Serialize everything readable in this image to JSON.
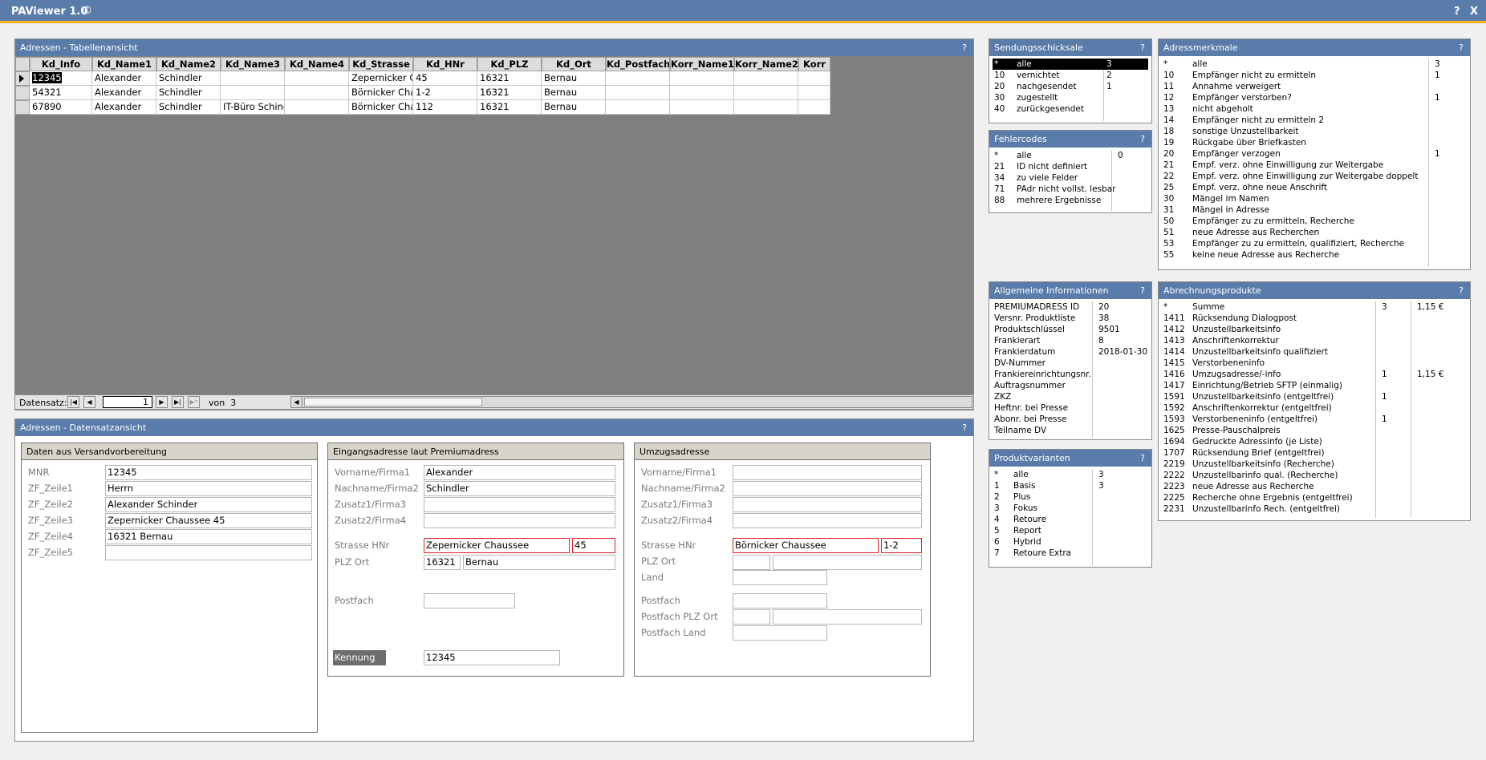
{
  "app": {
    "title": "PAViewer 1.0",
    "copyright": "©",
    "help": "?",
    "close": "X"
  },
  "table_panel": {
    "title": "Adressen - Tabellenansicht",
    "help": "?",
    "columns": [
      "Kd_Info",
      "Kd_Name1",
      "Kd_Name2",
      "Kd_Name3",
      "Kd_Name4",
      "Kd_Strasse",
      "Kd_HNr",
      "Kd_PLZ",
      "Kd_Ort",
      "Kd_Postfach",
      "Korr_Name1",
      "Korr_Name2",
      "Korr"
    ],
    "rows": [
      [
        "12345",
        "Alexander",
        "Schindler",
        "",
        "",
        "Zepernicker Ch",
        "45",
        "16321",
        "Bernau",
        "",
        "",
        "",
        ""
      ],
      [
        "54321",
        "Alexander",
        "Schindler",
        "",
        "",
        "Börnicker Chau",
        "1-2",
        "16321",
        "Bernau",
        "",
        "",
        "",
        ""
      ],
      [
        "67890",
        "Alexander",
        "Schindler",
        "IT-Büro Schindl",
        "",
        "Börnicker Chau",
        "112",
        "16321",
        "Bernau",
        "",
        "",
        "",
        ""
      ]
    ],
    "nav": {
      "label": "Datensatz:",
      "current": "1",
      "of_label": "von",
      "total": "3",
      "first": "|◀",
      "prev": "◀",
      "next": "▶",
      "last": "▶|",
      "new": "▶*"
    }
  },
  "detail_panel": {
    "title": "Adressen - Datensatzansicht",
    "help": "?",
    "versand": {
      "title": "Daten aus Versandvorbereitung",
      "fields": [
        {
          "label": "MNR",
          "value": "12345"
        },
        {
          "label": "ZF_Zeile1",
          "value": "Herrn"
        },
        {
          "label": "ZF_Zeile2",
          "value": "Alexander Schinder"
        },
        {
          "label": "ZF_Zeile3",
          "value": "Zepernicker Chaussee 45"
        },
        {
          "label": "ZF_Zeile4",
          "value": "16321 Bernau"
        },
        {
          "label": "ZF_Zeile5",
          "value": ""
        }
      ]
    },
    "eingang": {
      "title": "Eingangsadresse laut Premiumadress",
      "fields": [
        {
          "label": "Vorname/Firma1",
          "value": "Alexander"
        },
        {
          "label": "Nachname/Firma2",
          "value": "Schindler"
        },
        {
          "label": "Zusatz1/Firma3",
          "value": ""
        },
        {
          "label": "Zusatz2/Firma4",
          "value": ""
        }
      ],
      "strasse_label": "Strasse HNr",
      "strasse": "Zepernicker Chaussee",
      "hnr": "45",
      "plz_label": "PLZ Ort",
      "plz": "16321",
      "ort": "Bernau",
      "postfach_label": "Postfach",
      "postfach": "",
      "kennung_label": "Kennung",
      "kennung": "12345"
    },
    "umzug": {
      "title": "Umzugsadresse",
      "fields": [
        {
          "label": "Vorname/Firma1",
          "value": ""
        },
        {
          "label": "Nachname/Firma2",
          "value": ""
        },
        {
          "label": "Zusatz1/Firma3",
          "value": ""
        },
        {
          "label": "Zusatz2/Firma4",
          "value": ""
        }
      ],
      "strasse_label": "Strasse HNr",
      "strasse": "Börnicker Chaussee",
      "hnr": "1-2",
      "plz_label": "PLZ Ort",
      "plz": "",
      "ort": "",
      "land_label": "Land",
      "land": "",
      "postfach_label": "Postfach",
      "postfach": "",
      "postfach_plz_label": "Postfach PLZ Ort",
      "postfach_plz": "",
      "postfach_ort": "",
      "postfach_land_label": "Postfach Land",
      "postfach_land": ""
    }
  },
  "sendung": {
    "title": "Sendungsschicksale",
    "help": "?",
    "rows": [
      [
        "*",
        "alle",
        "3"
      ],
      [
        "10",
        "vernichtet",
        "2"
      ],
      [
        "20",
        "nachgesendet",
        "1"
      ],
      [
        "30",
        "zugestellt",
        ""
      ],
      [
        "40",
        "zurückgesendet",
        ""
      ]
    ]
  },
  "fehler": {
    "title": "Fehlercodes",
    "help": "?",
    "rows": [
      [
        "*",
        "alle",
        "0"
      ],
      [
        "21",
        "ID nicht definiert",
        ""
      ],
      [
        "34",
        "zu viele Felder",
        ""
      ],
      [
        "71",
        "PAdr nicht vollst. lesbar",
        ""
      ],
      [
        "88",
        "mehrere Ergebnisse",
        ""
      ]
    ]
  },
  "allg": {
    "title": "Allgemeine Informationen",
    "help": "?",
    "rows": [
      [
        "PREMIUMADRESS ID",
        "20"
      ],
      [
        "Versnr. Produktliste",
        "38"
      ],
      [
        "Produktschlüssel",
        "9501"
      ],
      [
        "Frankierart",
        "8"
      ],
      [
        "Frankierdatum",
        "2018-01-30"
      ],
      [
        "DV-Nummer",
        ""
      ],
      [
        "Frankiereinrichtungsnr.",
        ""
      ],
      [
        "Auftragsnummer",
        ""
      ],
      [
        "ZKZ",
        ""
      ],
      [
        "Heftnr. bei Presse",
        ""
      ],
      [
        "Abonr. bei Presse",
        ""
      ],
      [
        "Teilname DV",
        ""
      ]
    ]
  },
  "produkt": {
    "title": "Produktvarianten",
    "help": "?",
    "rows": [
      [
        "*",
        "alle",
        "3"
      ],
      [
        "1",
        "Basis",
        "3"
      ],
      [
        "2",
        "Plus",
        ""
      ],
      [
        "3",
        "Fokus",
        ""
      ],
      [
        "4",
        "Retoure",
        ""
      ],
      [
        "5",
        "Report",
        ""
      ],
      [
        "6",
        "Hybrid",
        ""
      ],
      [
        "7",
        "Retoure Extra",
        ""
      ]
    ]
  },
  "adress": {
    "title": "Adressmerkmale",
    "help": "?",
    "rows": [
      [
        "*",
        "alle",
        "3"
      ],
      [
        "10",
        "Empfänger nicht zu ermitteln",
        "1"
      ],
      [
        "11",
        "Annahme verweigert",
        ""
      ],
      [
        "12",
        "Empfänger verstorben?",
        "1"
      ],
      [
        "13",
        "nicht abgeholt",
        ""
      ],
      [
        "14",
        "Empfänger nicht zu ermitteln 2",
        ""
      ],
      [
        "18",
        "sonstige Unzustellbarkeit",
        ""
      ],
      [
        "19",
        "Rückgabe über Briefkasten",
        ""
      ],
      [
        "20",
        "Empfänger verzogen",
        "1"
      ],
      [
        "21",
        "Empf. verz. ohne Einwilligung zur Weitergabe",
        ""
      ],
      [
        "22",
        "Empf. verz. ohne Einwilligung zur Weitergabe doppelt",
        ""
      ],
      [
        "25",
        "Empf. verz. ohne neue Anschrift",
        ""
      ],
      [
        "30",
        "Mängel im Namen",
        ""
      ],
      [
        "31",
        "Mängel in Adresse",
        ""
      ],
      [
        "50",
        "Empfänger zu zu ermitteln, Recherche",
        ""
      ],
      [
        "51",
        "neue Adresse aus Recherchen",
        ""
      ],
      [
        "53",
        "Empfänger zu zu ermitteln, qualifiziert, Recherche",
        ""
      ],
      [
        "55",
        "keine neue Adresse aus Recherche",
        ""
      ]
    ]
  },
  "abrech": {
    "title": "Abrechnungsprodukte",
    "help": "?",
    "rows": [
      [
        "*",
        "Summe",
        "3",
        "1,15 €"
      ],
      [
        "1411",
        "Rücksendung Dialogpost",
        "",
        ""
      ],
      [
        "1412",
        "Unzustellbarkeitsinfo",
        "",
        ""
      ],
      [
        "1413",
        "Anschriftenkorrektur",
        "",
        ""
      ],
      [
        "1414",
        "Unzustellbarkeitsinfo qualifiziert",
        "",
        ""
      ],
      [
        "1415",
        "Verstorbeneninfo",
        "",
        ""
      ],
      [
        "1416",
        "Umzugsadresse/-info",
        "1",
        "1,15 €"
      ],
      [
        "1417",
        "Einrichtung/Betrieb SFTP (einmalig)",
        "",
        ""
      ],
      [
        "1591",
        "Unzustellbarkeitsinfo (entgeltfrei)",
        "1",
        ""
      ],
      [
        "1592",
        "Anschriftenkorrektur (entgeltfrei)",
        "",
        ""
      ],
      [
        "1593",
        "Verstorbeneninfo (entgeltfrei)",
        "1",
        ""
      ],
      [
        "1625",
        "Presse-Pauschalpreis",
        "",
        ""
      ],
      [
        "1694",
        "Gedruckte Adressinfo (je Liste)",
        "",
        ""
      ],
      [
        "1707",
        "Rücksendung Brief (entgeltfrei)",
        "",
        ""
      ],
      [
        "2219",
        "Unzustellbarkeitsinfo (Recherche)",
        "",
        ""
      ],
      [
        "2222",
        "Unzustellbarinfo qual. (Recherche)",
        "",
        ""
      ],
      [
        "2223",
        "neue Adresse aus Recherche",
        "",
        ""
      ],
      [
        "2225",
        "Recherche ohne Ergebnis (entgeltfrei)",
        "",
        ""
      ],
      [
        "2231",
        "Unzustellbarinfo Rech. (entgeltfrei)",
        "",
        ""
      ]
    ]
  }
}
